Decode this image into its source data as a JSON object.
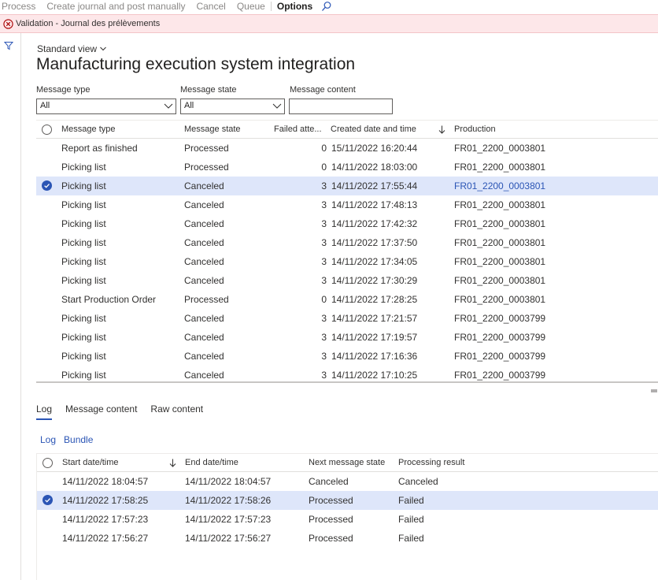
{
  "toolbar": {
    "process": "Process",
    "create_journal": "Create journal and post manually",
    "cancel": "Cancel",
    "queue": "Queue",
    "options": "Options"
  },
  "error": {
    "message": "Validation - Journal des prélèvements"
  },
  "view": {
    "name": "Standard view"
  },
  "page": {
    "title": "Manufacturing execution system integration"
  },
  "filters": {
    "type_label": "Message type",
    "type_value": "All",
    "state_label": "Message state",
    "state_value": "All",
    "content_label": "Message content",
    "content_value": ""
  },
  "messages": {
    "headers": {
      "type": "Message type",
      "state": "Message state",
      "failed": "Failed atte...",
      "created": "Created date and time",
      "production": "Production"
    },
    "rows": [
      {
        "type": "Report as finished",
        "state": "Processed",
        "failed": "0",
        "created": "15/11/2022 16:20:44",
        "production": "FR01_2200_0003801"
      },
      {
        "type": "Picking list",
        "state": "Processed",
        "failed": "0",
        "created": "14/11/2022 18:03:00",
        "production": "FR01_2200_0003801"
      },
      {
        "type": "Picking list",
        "state": "Canceled",
        "failed": "3",
        "created": "14/11/2022 17:55:44",
        "production": "FR01_2200_0003801"
      },
      {
        "type": "Picking list",
        "state": "Canceled",
        "failed": "3",
        "created": "14/11/2022 17:48:13",
        "production": "FR01_2200_0003801"
      },
      {
        "type": "Picking list",
        "state": "Canceled",
        "failed": "3",
        "created": "14/11/2022 17:42:32",
        "production": "FR01_2200_0003801"
      },
      {
        "type": "Picking list",
        "state": "Canceled",
        "failed": "3",
        "created": "14/11/2022 17:37:50",
        "production": "FR01_2200_0003801"
      },
      {
        "type": "Picking list",
        "state": "Canceled",
        "failed": "3",
        "created": "14/11/2022 17:34:05",
        "production": "FR01_2200_0003801"
      },
      {
        "type": "Picking list",
        "state": "Canceled",
        "failed": "3",
        "created": "14/11/2022 17:30:29",
        "production": "FR01_2200_0003801"
      },
      {
        "type": "Start Production Order",
        "state": "Processed",
        "failed": "0",
        "created": "14/11/2022 17:28:25",
        "production": "FR01_2200_0003801"
      },
      {
        "type": "Picking list",
        "state": "Canceled",
        "failed": "3",
        "created": "14/11/2022 17:21:57",
        "production": "FR01_2200_0003799"
      },
      {
        "type": "Picking list",
        "state": "Canceled",
        "failed": "3",
        "created": "14/11/2022 17:19:57",
        "production": "FR01_2200_0003799"
      },
      {
        "type": "Picking list",
        "state": "Canceled",
        "failed": "3",
        "created": "14/11/2022 17:16:36",
        "production": "FR01_2200_0003799"
      },
      {
        "type": "Picking list",
        "state": "Canceled",
        "failed": "3",
        "created": "14/11/2022 17:10:25",
        "production": "FR01_2200_0003799"
      }
    ]
  },
  "tabs": {
    "log": "Log",
    "message_content": "Message content",
    "raw_content": "Raw content"
  },
  "subtabs": {
    "log": "Log",
    "bundle": "Bundle"
  },
  "log": {
    "headers": {
      "start": "Start date/time",
      "end": "End date/time",
      "next_state": "Next message state",
      "result": "Processing result"
    },
    "rows": [
      {
        "start": "14/11/2022 18:04:57",
        "end": "14/11/2022 18:04:57",
        "next_state": "Canceled",
        "result": "Canceled"
      },
      {
        "start": "14/11/2022 17:58:25",
        "end": "14/11/2022 17:58:26",
        "next_state": "Processed",
        "result": "Failed"
      },
      {
        "start": "14/11/2022 17:57:23",
        "end": "14/11/2022 17:57:23",
        "next_state": "Processed",
        "result": "Failed"
      },
      {
        "start": "14/11/2022 17:56:27",
        "end": "14/11/2022 17:56:27",
        "next_state": "Processed",
        "result": "Failed"
      }
    ]
  }
}
